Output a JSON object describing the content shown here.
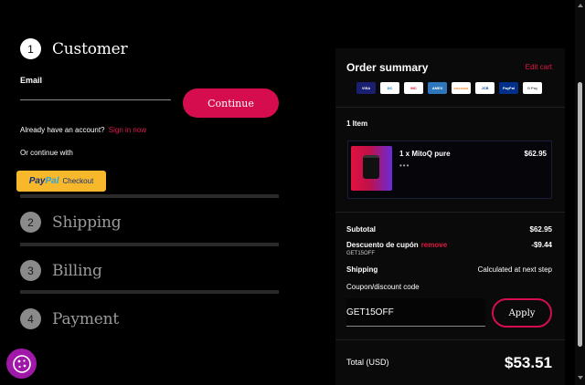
{
  "steps": [
    {
      "number": "1",
      "title": "Customer"
    },
    {
      "number": "2",
      "title": "Shipping"
    },
    {
      "number": "3",
      "title": "Billing"
    },
    {
      "number": "4",
      "title": "Payment"
    }
  ],
  "customer": {
    "email_label": "Email",
    "email_value": "",
    "continue_label": "Continue",
    "account_prompt": "Already have an account?",
    "sign_in_label": "Sign in now",
    "continue_with": "Or continue with",
    "paypal_pay": "Pay",
    "paypal_pal": "Pal",
    "paypal_checkout": "Checkout"
  },
  "summary": {
    "title": "Order summary",
    "edit_cart": "Edit cart",
    "payment_icons": [
      {
        "label": "VISA",
        "color": "#1a1f71"
      },
      {
        "label": "DC",
        "color": "#0079be"
      },
      {
        "label": "MC",
        "color": "#ffffff"
      },
      {
        "label": "AMEX",
        "color": "#2e77bc"
      },
      {
        "label": "DISCOVER",
        "color": "#ffffff"
      },
      {
        "label": "JCB",
        "color": "#ffffff"
      },
      {
        "label": "PayPal",
        "color": "#003087"
      },
      {
        "label": "G Pay",
        "color": "#ffffff"
      }
    ],
    "item_count": "1 Item",
    "item": {
      "name": "1 x MitoQ pure",
      "price": "$62.95",
      "dots": "•••"
    },
    "subtotal_label": "Subtotal",
    "subtotal_value": "$62.95",
    "coupon_label": "Descuento de cupón",
    "coupon_remove": "remove",
    "coupon_code": "GET15OFF",
    "coupon_value": "-$9.44",
    "shipping_label": "Shipping",
    "shipping_value": "Calculated at next step",
    "code_label": "Coupon/discount code",
    "code_input_value": "GET15OFF",
    "apply_label": "Apply",
    "total_label": "Total (USD)",
    "total_value": "$53.51"
  },
  "colors": {
    "accent": "#d50d4f",
    "link": "#e0183f",
    "paypal": "#f7b82b"
  }
}
